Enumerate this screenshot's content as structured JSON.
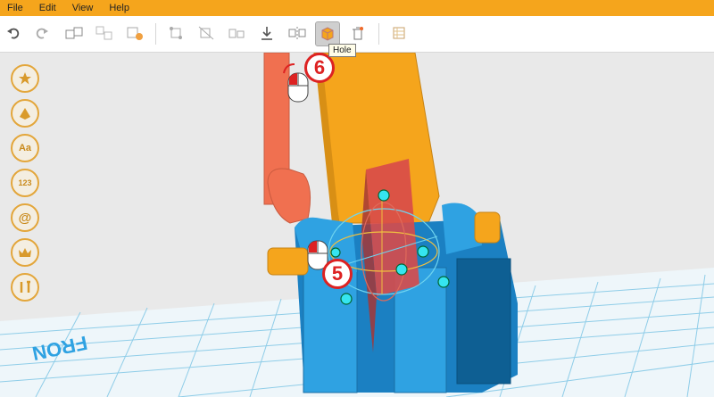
{
  "menu": [
    "File",
    "Edit",
    "View",
    "Help"
  ],
  "toolbar": {
    "icons": [
      "undo-icon",
      "redo-icon",
      "group-icon",
      "ungroup-icon",
      "add-box-icon",
      "move-icon",
      "scale-icon",
      "align-icon",
      "drop-icon",
      "mirror-icon",
      "hole-icon",
      "delete-icon",
      "table-icon"
    ],
    "tooltip": "Hole"
  },
  "sidebar": {
    "items": [
      {
        "icon": "star-icon",
        "label": ""
      },
      {
        "icon": "shape-icon",
        "label": ""
      },
      {
        "icon": "text-icon",
        "label": "Aa"
      },
      {
        "icon": "numbers-icon",
        "label": "123"
      },
      {
        "icon": "symbol-icon",
        "label": "@"
      },
      {
        "icon": "crown-icon",
        "label": ""
      },
      {
        "icon": "tools-icon",
        "label": ""
      }
    ]
  },
  "canvas": {
    "grid_label": "FRON",
    "step_markers": [
      "6",
      "5"
    ],
    "colors": {
      "orange": "#f5a51c",
      "blue": "#2fa2e2",
      "red": "#d84a4a",
      "grid": "#7cc6e6"
    }
  }
}
